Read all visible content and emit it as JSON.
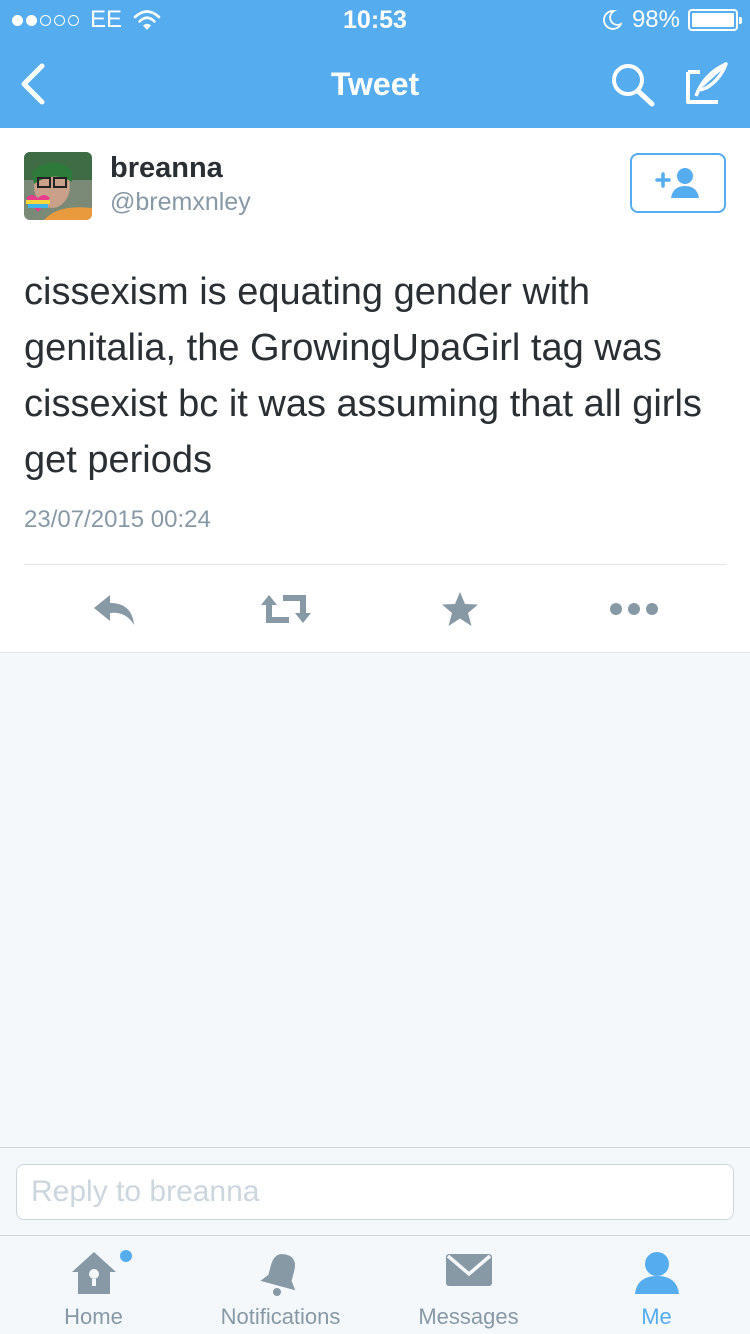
{
  "status_bar": {
    "carrier": "EE",
    "time": "10:53",
    "battery": "98%",
    "battery_level": 0.98,
    "signal_bars": 2
  },
  "nav": {
    "title": "Tweet",
    "back_icon": "chevron-left-icon",
    "search_icon": "search-icon",
    "compose_icon": "compose-icon"
  },
  "tweet": {
    "name": "breanna",
    "handle": "@bremxnley",
    "text": "cissexism is equating gender with genitalia, the GrowingUpaGirl tag was cissexist bc it was assuming that all girls get periods",
    "timestamp": "23/07/2015 00:24",
    "follow_icon": "add-user-icon",
    "actions": [
      "reply-icon",
      "retweet-icon",
      "favorite-icon",
      "more-icon"
    ]
  },
  "reply": {
    "placeholder": "Reply to breanna"
  },
  "tab_bar": {
    "tabs": [
      {
        "label": "Home",
        "icon": "home-icon",
        "active": false,
        "has_badge": true
      },
      {
        "label": "Notifications",
        "icon": "bell-icon",
        "active": false
      },
      {
        "label": "Messages",
        "icon": "envelope-icon",
        "active": false
      },
      {
        "label": "Me",
        "icon": "person-icon",
        "active": true
      }
    ]
  },
  "colors": {
    "brand": "#55acee",
    "text": "#292f33",
    "secondary_text": "#8899a6",
    "background": "#f5f8fa"
  }
}
